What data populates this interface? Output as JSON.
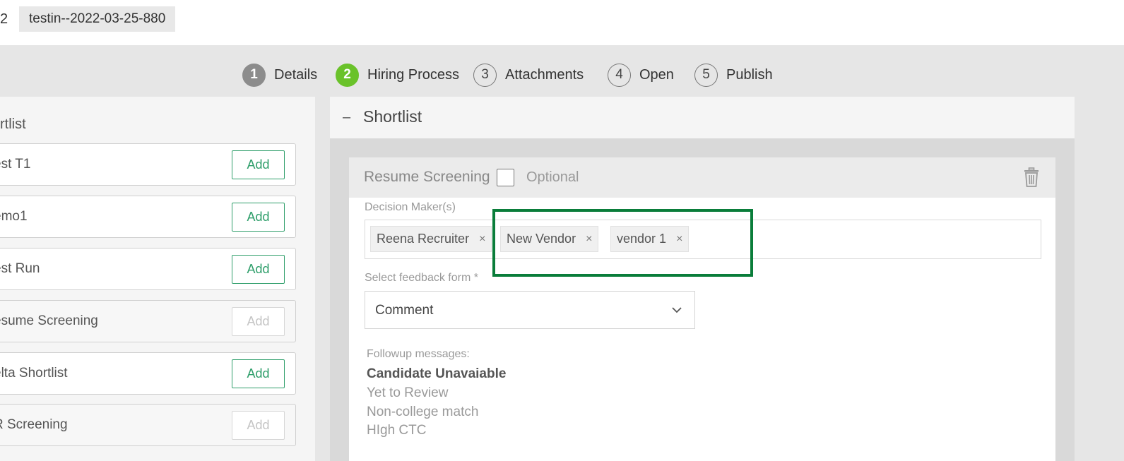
{
  "topbar": {
    "prefix": "2",
    "job_chip": "testin--2022-03-25-880"
  },
  "steps": [
    {
      "num": "1",
      "label": "Details",
      "state": "done"
    },
    {
      "num": "2",
      "label": "Hiring Process",
      "state": "active"
    },
    {
      "num": "3",
      "label": "Attachments",
      "state": "todo"
    },
    {
      "num": "4",
      "label": "Open",
      "state": "todo"
    },
    {
      "num": "5",
      "label": "Publish",
      "state": "todo"
    }
  ],
  "left_panel": {
    "title": "rtlist",
    "items": [
      {
        "label": "est T1",
        "add": "Add",
        "disabled": false
      },
      {
        "label": "emo1",
        "add": "Add",
        "disabled": false
      },
      {
        "label": "est Run",
        "add": "Add",
        "disabled": false
      },
      {
        "label": "esume Screening",
        "add": "Add",
        "disabled": true
      },
      {
        "label": "elta Shortlist",
        "add": "Add",
        "disabled": false
      },
      {
        "label": "R Screening",
        "add": "Add",
        "disabled": true
      }
    ]
  },
  "right_panel": {
    "collapse_symbol": "–",
    "title": "Shortlist",
    "card": {
      "title": "Resume Screening",
      "optional_label": "Optional",
      "decision_makers_label": "Decision Maker(s)",
      "decision_makers": [
        {
          "name": "Reena Recruiter",
          "remove": "×"
        },
        {
          "name": "New Vendor",
          "remove": "×"
        },
        {
          "name": "vendor 1",
          "remove": "×"
        }
      ],
      "feedback_label": "Select feedback form *",
      "feedback_value": "Comment",
      "followup_label": "Followup messages:",
      "followup_messages": [
        "Candidate Unavaiable",
        "Yet to Review",
        "Non-college match",
        "HIgh CTC"
      ]
    }
  },
  "colors": {
    "active_step": "#6ac22a",
    "add_button": "#2e9e6a",
    "highlight": "#0a7d3a"
  }
}
